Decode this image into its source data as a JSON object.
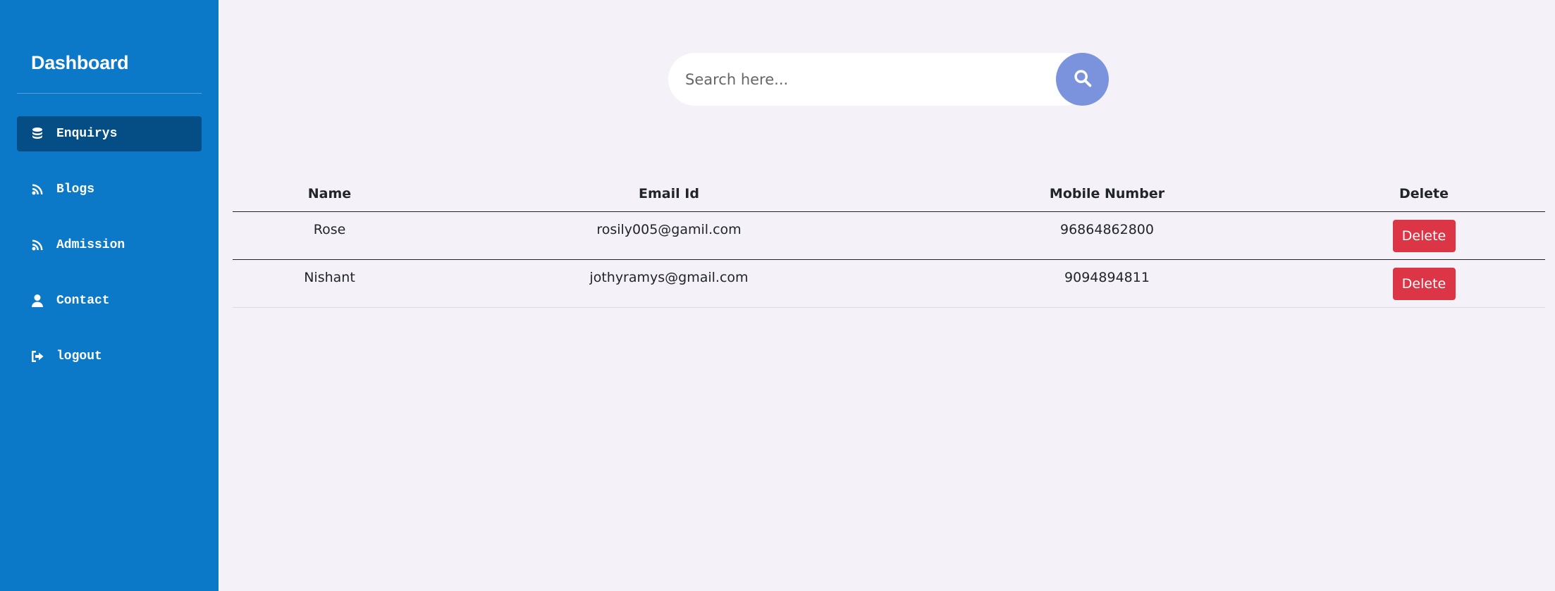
{
  "sidebar": {
    "title": "Dashboard",
    "items": [
      {
        "label": "Enquirys",
        "icon": "database-icon",
        "active": true
      },
      {
        "label": "Blogs",
        "icon": "feed-icon",
        "active": false
      },
      {
        "label": "Admission",
        "icon": "feed-icon",
        "active": false
      },
      {
        "label": "Contact",
        "icon": "user-icon",
        "active": false
      },
      {
        "label": "logout",
        "icon": "logout-icon",
        "active": false
      }
    ]
  },
  "search": {
    "placeholder": "Search here...",
    "icon": "search-icon"
  },
  "table": {
    "headers": [
      "Name",
      "Email Id",
      "Mobile Number",
      "Delete"
    ],
    "rows": [
      {
        "name": "Rose",
        "email": "rosily005@gamil.com",
        "mobile": "96864862800",
        "action": "Delete"
      },
      {
        "name": "Nishant",
        "email": "jothyramys@gmail.com",
        "mobile": "9094894811",
        "action": "Delete"
      }
    ]
  },
  "colors": {
    "sidebar_bg": "#0b78c8",
    "active_item_bg": "#044e85",
    "page_bg": "#f4f1f8",
    "search_button": "#7b93dd",
    "delete_button": "#dc3545"
  }
}
